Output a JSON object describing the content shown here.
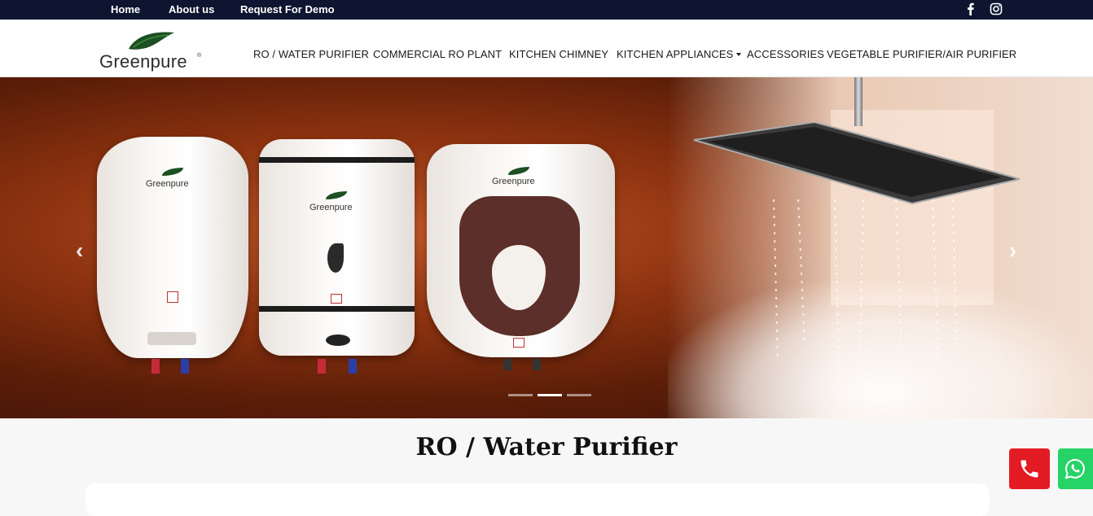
{
  "topbar": {
    "links": [
      "Home",
      "About us",
      "Request For Demo"
    ],
    "icons": [
      "facebook-icon",
      "instagram-icon"
    ]
  },
  "brand": {
    "name": "Greenpure",
    "registered": "®"
  },
  "nav": {
    "items": [
      "RO / WATER PURIFIER",
      "COMMERCIAL RO PLANT",
      "KITCHEN CHIMNEY",
      "KITCHEN APPLIANCES",
      "ACCESSORIES",
      "VEGETABLE PURIFIER/AIR PURIFIER"
    ]
  },
  "hero": {
    "product_brand": "Greenpure",
    "slide_count": 3,
    "active_slide": 2,
    "prev_icon": "chevron-left-icon",
    "next_icon": "chevron-right-icon"
  },
  "section": {
    "title": "RO / Water Purifier"
  },
  "floating": {
    "call_icon": "phone-icon",
    "whatsapp_icon": "whatsapp-icon"
  },
  "colors": {
    "topbar_bg": "#0e1530",
    "leaf_green": "#1c4f22",
    "call_red": "#e31b23",
    "whatsapp_green": "#25d366"
  }
}
